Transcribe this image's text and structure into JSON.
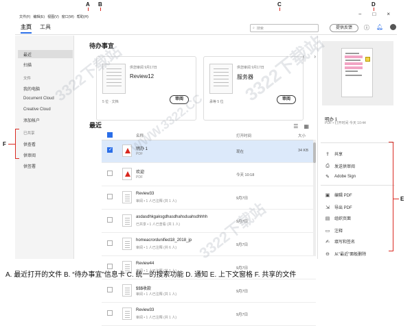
{
  "menu": [
    "文件(F)",
    "编辑(E)",
    "视图(V)",
    "窗口(W)",
    "帮助(H)"
  ],
  "tabs": [
    {
      "label": "主页",
      "active": true
    },
    {
      "label": "工具",
      "active": false
    }
  ],
  "search": {
    "placeholder": "搜索"
  },
  "trial_button": "提供反馈",
  "window_controls": {
    "minimize": "−",
    "maximize": "□",
    "close": "×"
  },
  "sidebar": {
    "recent": "最近",
    "scan": "扫描",
    "files_group": "文件",
    "my_computer": "我的电脑",
    "document_cloud": "Document Cloud",
    "creative_cloud": "Creative Cloud",
    "add_account": "添加帐户",
    "shared_group": "已共享",
    "shared_items": [
      "供查看",
      "供审阅",
      "供签署"
    ]
  },
  "agenda": {
    "title": "待办事宜",
    "cards": [
      {
        "meta": "供您审阅 9月17日",
        "title": "Review12",
        "footer": "5 位 · 文档",
        "button": "审阅"
      },
      {
        "meta": "供您审阅 9月17日",
        "title": "服务器",
        "footer": "承等 5 位",
        "button": "审阅"
      }
    ],
    "prev": "‹",
    "next": "›"
  },
  "recent": {
    "title": "最近",
    "columns": {
      "name": "名称",
      "opened": "打开时间",
      "size": "大小"
    },
    "rows": [
      {
        "name": "明办 1",
        "sub": "PDF",
        "time": "现在",
        "size": "34 KB",
        "selected": true,
        "icon": "pdf"
      },
      {
        "name": "欢迎",
        "sub": "PDF",
        "time": "今天 10:18",
        "size": "",
        "selected": false,
        "icon": "pdf"
      },
      {
        "name": "Review33",
        "sub": "审阅 • 1 人已注释 (共 1 人)",
        "time": "9月7日",
        "size": "",
        "selected": false,
        "icon": "doc"
      },
      {
        "name": "asdasdhkgaksgdhasdhahsduahsdhhhh",
        "sub": "已共享 • 1 人已查看 (共 1 人)",
        "time": "9月7日",
        "size": "",
        "selected": false,
        "icon": "doc"
      },
      {
        "name": "homeacrordunified18_2018_jp",
        "sub": "审阅 • 1 人已注释 (共 6 人)",
        "time": "9月7日",
        "size": "",
        "selected": false,
        "icon": "doc"
      },
      {
        "name": "Review44",
        "sub": "审阅 • 1 人已注释 (共 1 人)",
        "time": "9月7日",
        "size": "",
        "selected": false,
        "icon": "doc"
      },
      {
        "name": "$$$收款",
        "sub": "审阅 • 1 人已注释 (共 1 人)",
        "time": "9月7日",
        "size": "",
        "selected": false,
        "icon": "doc"
      },
      {
        "name": "Review33",
        "sub": "审阅 • 1 人已注释 (共 1 人)",
        "time": "9月7日",
        "size": "",
        "selected": false,
        "icon": "doc"
      }
    ]
  },
  "right_panel": {
    "file_name": "明办 1",
    "file_detail": "PDF • 打开时间 今天 10:44",
    "tools": [
      {
        "label": "共享",
        "icon": "share-icon",
        "glyph": "⇪"
      },
      {
        "label": "发送供审阅",
        "icon": "send-review-icon",
        "glyph": "⎙"
      },
      {
        "label": "Adobe Sign",
        "icon": "sign-icon",
        "glyph": "✎"
      },
      {
        "label": "编辑 PDF",
        "icon": "edit-pdf-icon",
        "glyph": "▣"
      },
      {
        "label": "导出 PDF",
        "icon": "export-pdf-icon",
        "glyph": "⇲"
      },
      {
        "label": "组织页面",
        "icon": "organize-pages-icon",
        "glyph": "▤"
      },
      {
        "label": "注释",
        "icon": "comment-icon",
        "glyph": "▭"
      },
      {
        "label": "填写和签名",
        "icon": "fill-sign-icon",
        "glyph": "✍"
      },
      {
        "label": "从\"最近\"面板删除",
        "icon": "remove-icon",
        "glyph": "⊖"
      }
    ]
  },
  "markers": {
    "A": "A",
    "B": "B",
    "C": "C",
    "D": "D",
    "E": "E",
    "F": "F"
  },
  "caption": "A. 最近打开的文件 B. “待办事宜”信息卡 C. 统一的搜索功能 D. 通知 E. 上下文窗格 F. 共享的文件",
  "watermark": "WWW.3322.CC",
  "watermark_brand": "3322下载站"
}
